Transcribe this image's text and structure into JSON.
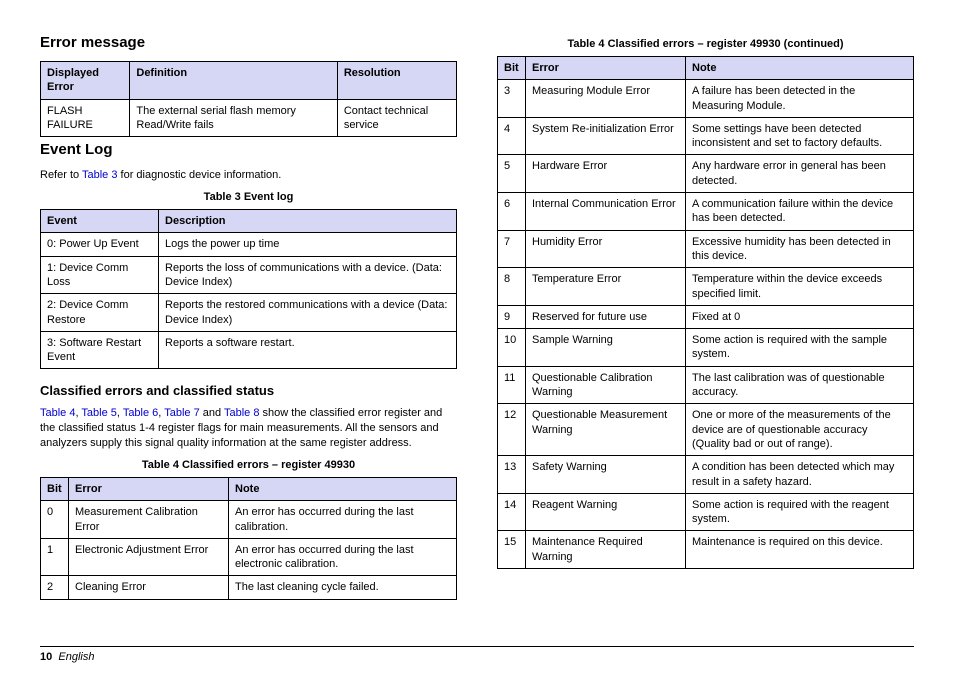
{
  "left": {
    "h_error_message": "Error message",
    "table1": {
      "headers": [
        "Displayed Error",
        "Definition",
        "Resolution"
      ],
      "rows": [
        [
          "FLASH FAILURE",
          "The external serial flash memory Read/Write fails",
          "Contact technical service"
        ]
      ]
    },
    "h_event_log": "Event Log",
    "event_log_intro_pre": "Refer to ",
    "event_log_link": "Table 3",
    "event_log_intro_post": " for diagnostic device information.",
    "table3_caption": "Table 3  Event log",
    "table3": {
      "headers": [
        "Event",
        "Description"
      ],
      "rows": [
        [
          "0: Power Up Event",
          "Logs the power up time"
        ],
        [
          "1: Device Comm Loss",
          "Reports the loss of communications with a device. (Data: Device Index)"
        ],
        [
          "2: Device Comm Restore",
          "Reports the restored communications with a device (Data: Device Index)"
        ],
        [
          "3: Software Restart Event",
          "Reports a software restart."
        ]
      ]
    },
    "h_classified": "Classified errors and classified status",
    "class_links": [
      "Table 4",
      "Table 5",
      "Table 6",
      "Table 7",
      "Table 8"
    ],
    "class_para_tail": " show the classified error register and the classified status 1-4 register flags for main measurements. All the sensors and analyzers supply this signal quality information at the same register address.",
    "table4_caption": "Table 4  Classified errors – register 49930",
    "table4": {
      "headers": [
        "Bit",
        "Error",
        "Note"
      ],
      "rows": [
        [
          "0",
          "Measurement Calibration Error",
          "An error has occurred during the last calibration."
        ],
        [
          "1",
          "Electronic Adjustment Error",
          "An error has occurred during the last electronic calibration."
        ],
        [
          "2",
          "Cleaning Error",
          "The last cleaning cycle failed."
        ]
      ]
    }
  },
  "right": {
    "table4c_caption": "Table 4  Classified errors – register 49930 (continued)",
    "table4c": {
      "headers": [
        "Bit",
        "Error",
        "Note"
      ],
      "rows": [
        [
          "3",
          "Measuring Module Error",
          "A failure has been detected in the Measuring Module."
        ],
        [
          "4",
          "System Re-initialization Error",
          "Some settings have been detected inconsistent and set to factory defaults."
        ],
        [
          "5",
          "Hardware Error",
          "Any hardware error in general has been detected."
        ],
        [
          "6",
          "Internal Communication Error",
          "A communication failure within the device has been detected."
        ],
        [
          "7",
          "Humidity Error",
          "Excessive humidity has been detected in this device."
        ],
        [
          "8",
          "Temperature Error",
          "Temperature within the device exceeds specified limit."
        ],
        [
          "9",
          "Reserved for future use",
          "Fixed at 0"
        ],
        [
          "10",
          "Sample Warning",
          "Some action is required with the sample system."
        ],
        [
          "11",
          "Questionable Calibration Warning",
          "The last calibration was of questionable accuracy."
        ],
        [
          "12",
          "Questionable Measurement Warning",
          "One or more of the measurements of the device are of questionable accuracy (Quality bad or out of range)."
        ],
        [
          "13",
          "Safety Warning",
          "A condition has been detected which may result in a safety hazard."
        ],
        [
          "14",
          "Reagent Warning",
          "Some action is required with the reagent system."
        ],
        [
          "15",
          "Maintenance Required Warning",
          "Maintenance is required on this device."
        ]
      ]
    }
  },
  "footer": {
    "page": "10",
    "lang": "English"
  }
}
